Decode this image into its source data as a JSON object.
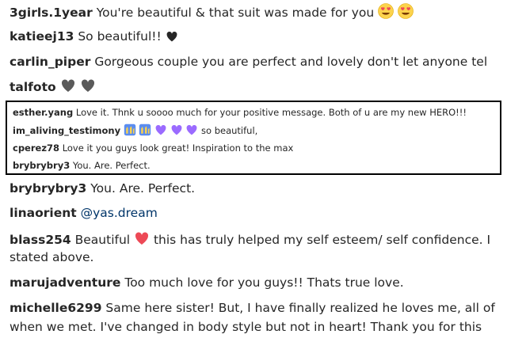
{
  "colors": {
    "heart_red": "#ed4956",
    "heart_gray": "#5a5a5a",
    "heart_purple": "#9b6bff",
    "emoji_yellow": "#fcd34d",
    "text": "#262626",
    "link": "#003569"
  },
  "comments": [
    {
      "user": "3girls.1year",
      "text": "You're beautiful & that suit was made for you",
      "emoji": [
        "heart-eyes",
        "heart-eyes"
      ]
    },
    {
      "user": "katieej13",
      "text": "So beautiful!!",
      "emoji": [
        "black-heart"
      ]
    },
    {
      "user": "carlin_piper",
      "text": "Gorgeous couple you are perfect and lovely don't let anyone tel"
    },
    {
      "user": "talfoto",
      "text": "",
      "emoji": [
        "gray-heart",
        "gray-heart"
      ]
    },
    {
      "user": "brybrybry3",
      "text": "You. Are. Perfect."
    },
    {
      "user": "linaorient",
      "text": "@yas.dream"
    },
    {
      "user": "blass254",
      "text": "Beautiful",
      "text_after_emoji": "this has truly helped my self esteem/ self confidence. I",
      "line2": "stated above.",
      "emoji": [
        "red-heart"
      ]
    },
    {
      "user": "marujadventure",
      "text": "Too much love for you guys!! Thats true love."
    },
    {
      "user": "michelle6299",
      "text": "Same here sister! But, I have finally realized he loves me, all of",
      "line2": "when we met. I've changed in body style but not in heart! Thank you for this"
    }
  ],
  "highlight_box": [
    {
      "user": "esther.yang",
      "text": "Love it. Thnk u soooo much for your positive message. Both of u are my new HERO!!!"
    },
    {
      "user": "im_aliving_testimony",
      "text": "so beautiful,",
      "emoji": [
        "praise-hands",
        "praise-hands",
        "purple-heart",
        "purple-heart",
        "purple-heart"
      ]
    },
    {
      "user": "cperez78",
      "text": "Love it you guys look great! Inspiration to the max"
    },
    {
      "user": "brybrybry3",
      "text": "You. Are. Perfect."
    }
  ]
}
